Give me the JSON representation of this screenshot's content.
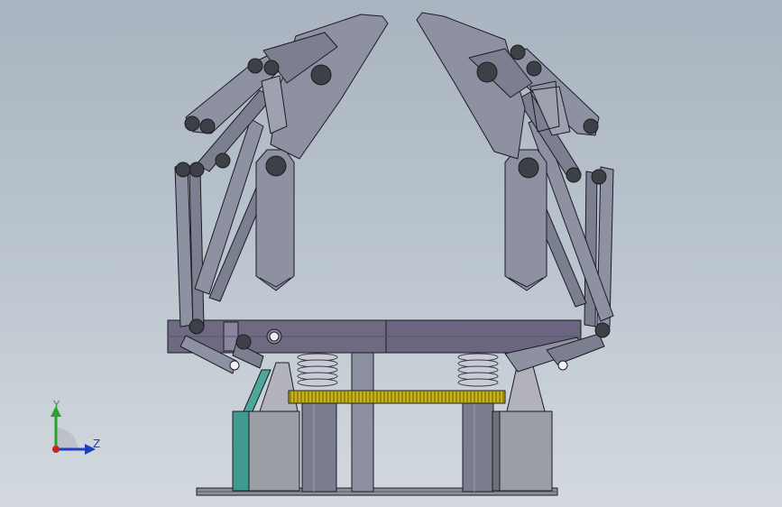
{
  "viewport": {
    "background_top": "#a9b4c0",
    "background_bottom": "#d3d9de"
  },
  "model": {
    "colors": {
      "link_fill": "#7b7f8f",
      "link_fill_light": "#8d91a1",
      "pin": "#3e4048",
      "outline": "#1c1c22",
      "plate": "#6e6a82",
      "plate_light": "#8a86a0",
      "post": "#7a7d90",
      "block": "#8e8f98",
      "spring": "#c9ccd6",
      "gear": "#c7b21a",
      "accent_teal": "#3f9a8f",
      "pedestal": "#9c9ea6"
    }
  },
  "triad": {
    "y_label": "Y",
    "z_label": "Z",
    "y_color": "#2ca02c",
    "z_color": "#1f3fbf",
    "x_color": "#c0262d"
  }
}
